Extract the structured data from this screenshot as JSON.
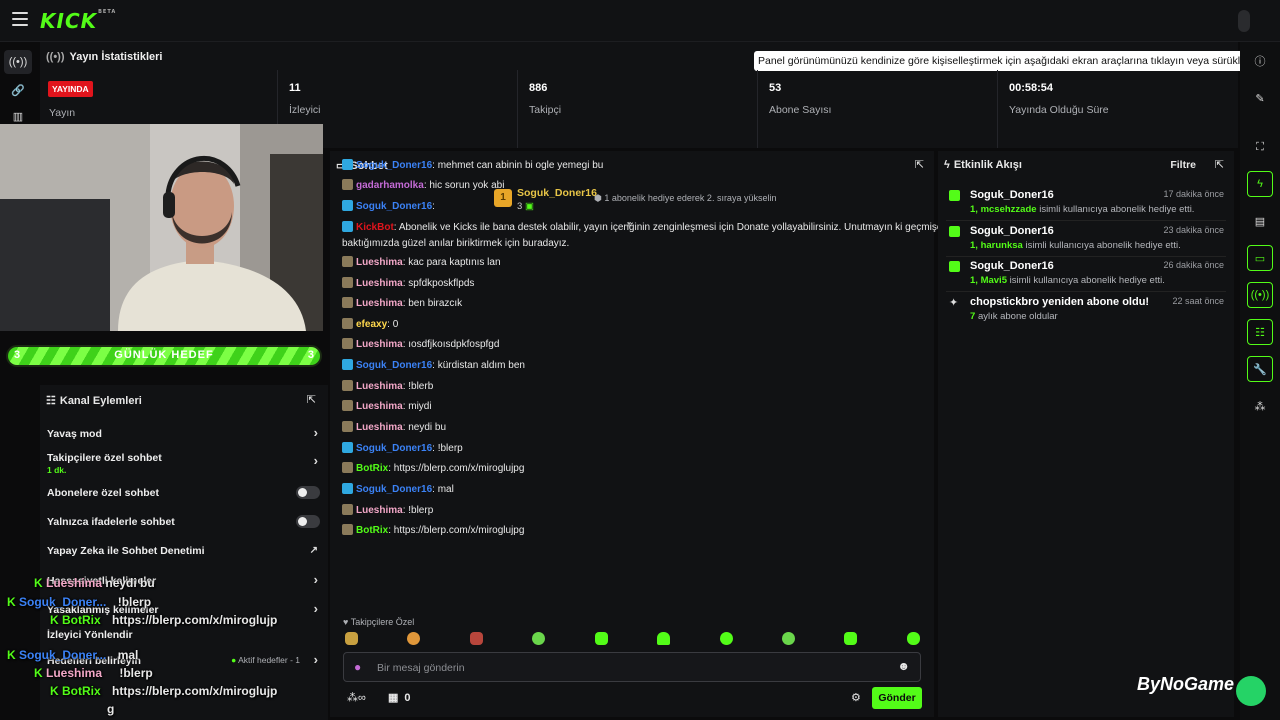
{
  "topbar": {
    "logo": "KICK",
    "logo_beta": "BETA"
  },
  "stats": {
    "title": "Yayın İstatistikleri",
    "tooltip": "Panel görünümünüzü kendinize göre kişiselleştirmek için aşağıdaki ekran araçlarına tıklayın veya sürükleyin",
    "live_badge": "YAYINDA",
    "live_label": "Yayın",
    "items": [
      {
        "value": "11",
        "label": "İzleyici"
      },
      {
        "value": "886",
        "label": "Takipçi"
      },
      {
        "value": "53",
        "label": "Abone Sayısı"
      },
      {
        "value": "00:58:54",
        "label": "Yayında Olduğu Süre"
      }
    ]
  },
  "goal": {
    "left": "3",
    "label": "GÜNLÜK HEDEF",
    "right": "3"
  },
  "channel": {
    "title": "Kanal Eylemleri",
    "rows": [
      {
        "label": "Yavaş mod",
        "kind": "chev"
      },
      {
        "label": "Takipçilere özel sohbet",
        "sub": "1 dk.",
        "kind": "chev"
      },
      {
        "label": "Abonelere özel sohbet",
        "kind": "toggle"
      },
      {
        "label": "Yalnızca ifadelerle sohbet",
        "kind": "toggle"
      },
      {
        "label": "Yapay Zeka ile Sohbet Denetimi",
        "kind": "icon"
      },
      {
        "label": "Hassasiyetli kelimeler",
        "kind": "chev"
      },
      {
        "label": "Yasaklanmış kelimeler",
        "kind": "chev"
      },
      {
        "label": "İzleyici Yönlendir",
        "kind": "none"
      },
      {
        "label": "Hedefleri belirleyin",
        "kind": "chev",
        "extra": "Aktif hedefler - 1"
      }
    ]
  },
  "overlay": [
    {
      "user": "Lueshima",
      "text": "neydi bu"
    },
    {
      "user": "Soguk_Doner...",
      "text": "!blerp"
    },
    {
      "user": "BotRix",
      "text": "https://blerp.com/x/miroglujp"
    },
    {
      "user": "Soguk_Doner...",
      "text": "mal"
    },
    {
      "user": "Lueshima",
      "text": "!blerp"
    },
    {
      "user": "BotRix",
      "text": "https://blerp.com/x/miroglujp"
    },
    {
      "user": "",
      "text": "g"
    }
  ],
  "chat": {
    "title": "Sohbet",
    "top_gifter": "Soguk_Doner16",
    "top_gifter_count": "3",
    "promo": "1 abonelik hediye ederek 2. sıraya yükselin",
    "messages": [
      {
        "user": "Soguk_Doner16",
        "color": "#3b82f6",
        "text": "mehmet can abinin bi ogle yemegi bu"
      },
      {
        "user": "gadarhamolka",
        "color": "#c46bd6",
        "text": "hic sorun yok abi"
      },
      {
        "user": "Soguk_Doner16",
        "color": "#3b82f6",
        "text": ""
      },
      {
        "user": "KickBot",
        "color": "#e1141c",
        "text": "Abonelik ve Kicks ile bana destek olabilir, yayın içeriğinin zenginleşmesi için Donate yollayabilirsiniz. Unutmayın ki geçmişe",
        "text2": "baktığımızda güzel anılar biriktirmek için buradayız."
      },
      {
        "user": "Lueshima",
        "color": "#f2a7c7",
        "text": "kac para kaptınıs lan"
      },
      {
        "user": "Lueshima",
        "color": "#f2a7c7",
        "text": "spfdkposkflpds"
      },
      {
        "user": "Lueshima",
        "color": "#f2a7c7",
        "text": "ben birazcık"
      },
      {
        "user": "efeaxy",
        "color": "#ffd84d",
        "text": "0"
      },
      {
        "user": "Lueshima",
        "color": "#f2a7c7",
        "text": "ıosdfjkoısdpkfospfgd"
      },
      {
        "user": "Soguk_Doner16",
        "color": "#3b82f6",
        "text": "kürdistan aldım ben"
      },
      {
        "user": "Lueshima",
        "color": "#f2a7c7",
        "text": "!blerb"
      },
      {
        "user": "Lueshima",
        "color": "#f2a7c7",
        "text": "miydi"
      },
      {
        "user": "Lueshima",
        "color": "#f2a7c7",
        "text": "neydi bu"
      },
      {
        "user": "Soguk_Doner16",
        "color": "#3b82f6",
        "text": "!blerp"
      },
      {
        "user": "BotRix",
        "color": "#53fc18",
        "text": "https://blerp.com/x/miroglujpg"
      },
      {
        "user": "Soguk_Doner16",
        "color": "#3b82f6",
        "text": "mal"
      },
      {
        "user": "Lueshima",
        "color": "#f2a7c7",
        "text": "!blerp"
      },
      {
        "user": "BotRix",
        "color": "#53fc18",
        "text": "https://blerp.com/x/miroglujpg"
      }
    ],
    "emote_label": "Takipçilere Özel",
    "placeholder": "Bir mesaj gönderin",
    "points": "0",
    "send": "Gönder"
  },
  "activity": {
    "title": "Etkinlik Akışı",
    "filter": "Filtre",
    "events": [
      {
        "name": "Soguk_Doner16",
        "count": "1,",
        "target": "mcsehzzade",
        "rest": "isimli kullanıcıya abonelik hediye etti.",
        "time": "17 dakika önce"
      },
      {
        "name": "Soguk_Doner16",
        "count": "1,",
        "target": "harunksa",
        "rest": "isimli kullanıcıya abonelik hediye etti.",
        "time": "23 dakika önce"
      },
      {
        "name": "Soguk_Doner16",
        "count": "1,",
        "target": "Mavi5",
        "rest": "isimli kullanıcıya abonelik hediye etti.",
        "time": "26 dakika önce"
      },
      {
        "name": "chopstickbro yeniden abone oldu!",
        "count": "7",
        "target": "",
        "rest": "aylık abone oldular",
        "time": "22 saat önce"
      }
    ]
  },
  "watermark": "ByNoGame"
}
